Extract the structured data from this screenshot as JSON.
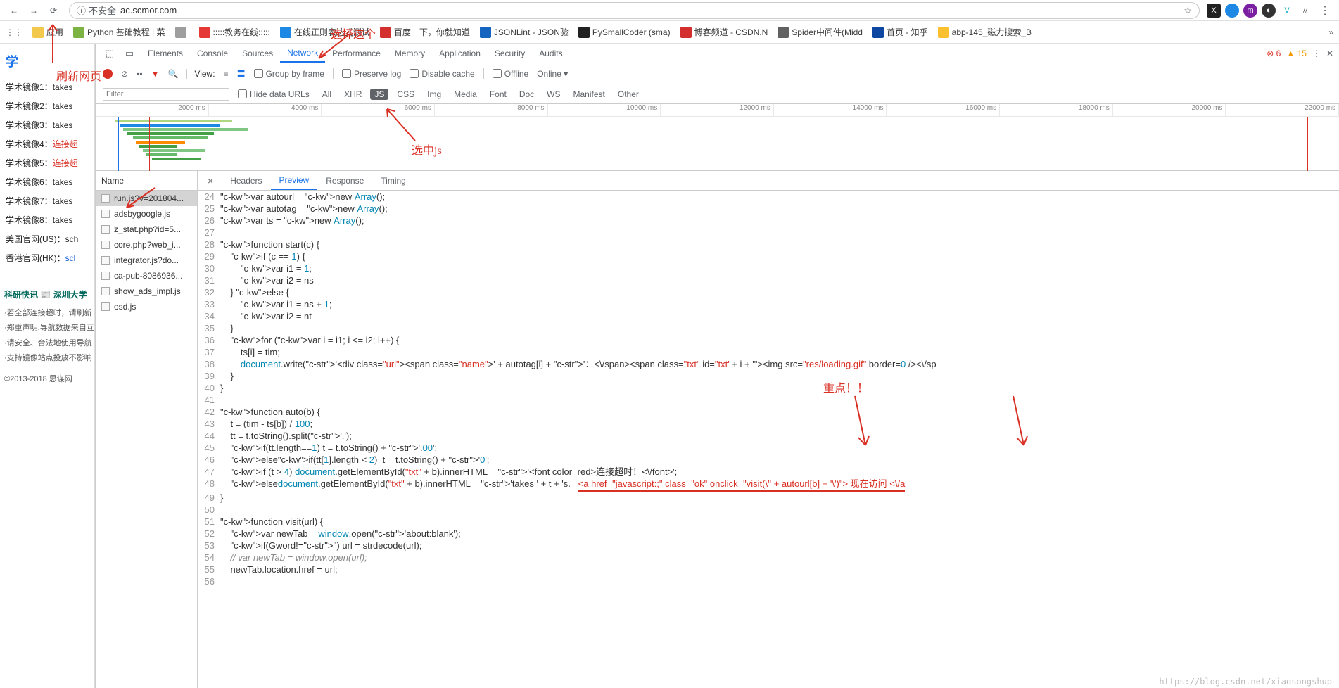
{
  "browser": {
    "url_prefix": "不安全",
    "url": "ac.scmor.com",
    "nav": {
      "back": "←",
      "forward": "→",
      "reload": "⟳"
    }
  },
  "bookmarks": [
    {
      "label": "应用",
      "color": "#f2c94c"
    },
    {
      "label": "Python 基础教程 | 菜",
      "color": "#7cb342"
    },
    {
      "label": "",
      "color": "#9e9e9e"
    },
    {
      "label": ":::::教务在线:::::",
      "color": "#e53935"
    },
    {
      "label": "在线正则表达式测试",
      "color": "#1e88e5"
    },
    {
      "label": "百度一下，你就知道",
      "color": "#d32f2f"
    },
    {
      "label": "JSONLint - JSON验",
      "color": "#1565c0"
    },
    {
      "label": "PySmallCoder (sma)",
      "color": "#212121"
    },
    {
      "label": "博客频道 - CSDN.N",
      "color": "#d32f2f"
    },
    {
      "label": "Spider中间件(Midd",
      "color": "#616161"
    },
    {
      "label": "首页 - 知乎",
      "color": "#0d47a1"
    },
    {
      "label": "abp-145_磁力搜索_B",
      "color": "#fbc02d"
    }
  ],
  "devtools": {
    "tabs": [
      "Elements",
      "Console",
      "Sources",
      "Network",
      "Performance",
      "Memory",
      "Application",
      "Security",
      "Audits"
    ],
    "active_tab": "Network",
    "errors": "6",
    "warnings": "15",
    "toolbar": {
      "view": "View:",
      "group_by_frame": "Group by frame",
      "preserve_log": "Preserve log",
      "disable_cache": "Disable cache",
      "offline": "Offline",
      "online": "Online"
    },
    "filter": {
      "placeholder": "Filter",
      "hide_data_urls": "Hide data URLs",
      "types": [
        "All",
        "XHR",
        "JS",
        "CSS",
        "Img",
        "Media",
        "Font",
        "Doc",
        "WS",
        "Manifest",
        "Other"
      ],
      "active_type": "JS"
    },
    "timeline_ticks": [
      "2000 ms",
      "4000 ms",
      "6000 ms",
      "8000 ms",
      "10000 ms",
      "12000 ms",
      "14000 ms",
      "16000 ms",
      "18000 ms",
      "20000 ms",
      "22000 ms"
    ],
    "name_header": "Name",
    "requests": [
      {
        "name": "run.js?v=201804...",
        "selected": true
      },
      {
        "name": "adsbygoogle.js"
      },
      {
        "name": "z_stat.php?id=5..."
      },
      {
        "name": "core.php?web_i..."
      },
      {
        "name": "integrator.js?do..."
      },
      {
        "name": "ca-pub-8086936..."
      },
      {
        "name": "show_ads_impl.js"
      },
      {
        "name": "osd.js"
      }
    ],
    "detail_tabs": [
      "Headers",
      "Preview",
      "Response",
      "Timing"
    ],
    "active_detail": "Preview"
  },
  "page_left": {
    "logo": "学",
    "mirrors": [
      {
        "label": "学术镜像1：",
        "status": "takes"
      },
      {
        "label": "学术镜像2：",
        "status": "takes"
      },
      {
        "label": "学术镜像3：",
        "status": "takes"
      },
      {
        "label": "学术镜像4：",
        "status": "连接超",
        "red": true
      },
      {
        "label": "学术镜像5：",
        "status": "连接超",
        "red": true
      },
      {
        "label": "学术镜像6：",
        "status": "takes"
      },
      {
        "label": "学术镜像7：",
        "status": "takes"
      },
      {
        "label": "学术镜像8：",
        "status": "takes"
      },
      {
        "label": "美国官网(US)：",
        "status": "sch"
      },
      {
        "label": "香港官网(HK)：",
        "status": "scl",
        "blue": true
      }
    ],
    "kx": "科研快讯",
    "kx2": "深圳大学",
    "notes": [
      "·若全部连接超时，请刷新",
      "·郑重声明:导航数据来自互",
      "·请安全、合法地使用导航",
      "·支持镜像站点投放不影响"
    ],
    "copyright": "©2013-2018 思谋网"
  },
  "annotations": {
    "refresh": "刷新网页",
    "select_tab": "选择这个",
    "select_js": "选中js",
    "focus": "重点！！"
  },
  "code_lines": [
    {
      "n": 24,
      "t": "var autourl = new Array();"
    },
    {
      "n": 25,
      "t": "var autotag = new Array();"
    },
    {
      "n": 26,
      "t": "var ts = new Array();"
    },
    {
      "n": 27,
      "t": ""
    },
    {
      "n": 28,
      "t": "function start(c) {"
    },
    {
      "n": 29,
      "t": "    if (c == 1) {"
    },
    {
      "n": 30,
      "t": "        var i1 = 1;"
    },
    {
      "n": 31,
      "t": "        var i2 = ns"
    },
    {
      "n": 32,
      "t": "    } else {"
    },
    {
      "n": 33,
      "t": "        var i1 = ns + 1;"
    },
    {
      "n": 34,
      "t": "        var i2 = nt"
    },
    {
      "n": 35,
      "t": "    }"
    },
    {
      "n": 36,
      "t": "    for (var i = i1; i <= i2; i++) {"
    },
    {
      "n": 37,
      "t": "        ts[i] = tim;"
    },
    {
      "n": 38,
      "t": "        document.write('<div class=\"url\"><span class=\"name\">' + autotag[i] + '：<\\/span><span class=\"txt\" id=\"txt' + i + '\"><img src=\"res/loading.gif\" border=0 /><\\/sp"
    },
    {
      "n": 39,
      "t": "    }"
    },
    {
      "n": 40,
      "t": "}"
    },
    {
      "n": 41,
      "t": ""
    },
    {
      "n": 42,
      "t": "function auto(b) {"
    },
    {
      "n": 43,
      "t": "    t = (tim - ts[b]) / 100;"
    },
    {
      "n": 44,
      "t": "    tt = t.toString().split('.');"
    },
    {
      "n": 45,
      "t": "    if(tt.length==1) t = t.toString() + '.00';"
    },
    {
      "n": 46,
      "t": "    else if(tt[1].length < 2)  t = t.toString() + '0';"
    },
    {
      "n": 47,
      "t": "    if (t > 4) document.getElementById(\"txt\" + b).innerHTML = '<font color=red>连接超时！<\\/font>';"
    },
    {
      "n": 48,
      "t": "    else document.getElementById(\"txt\" + b).innerHTML = 'takes ' + t + 's.   <a href=\"javascript:;\" class=\"ok\" onclick=\"visit(\\'' + autourl[b] + '\\')\"> 现在访问 <\\/a",
      "hl": true
    },
    {
      "n": 49,
      "t": "}"
    },
    {
      "n": 50,
      "t": ""
    },
    {
      "n": 51,
      "t": "function visit(url) {"
    },
    {
      "n": 52,
      "t": "    var newTab = window.open('about:blank');"
    },
    {
      "n": 53,
      "t": "    if(Gword!='') url = strdecode(url);"
    },
    {
      "n": 54,
      "t": "    // var newTab = window.open(url);",
      "cm": true
    },
    {
      "n": 55,
      "t": "    newTab.location.href = url;"
    },
    {
      "n": 56,
      "t": ""
    }
  ],
  "watermark": "https://blog.csdn.net/xiaosongshup"
}
